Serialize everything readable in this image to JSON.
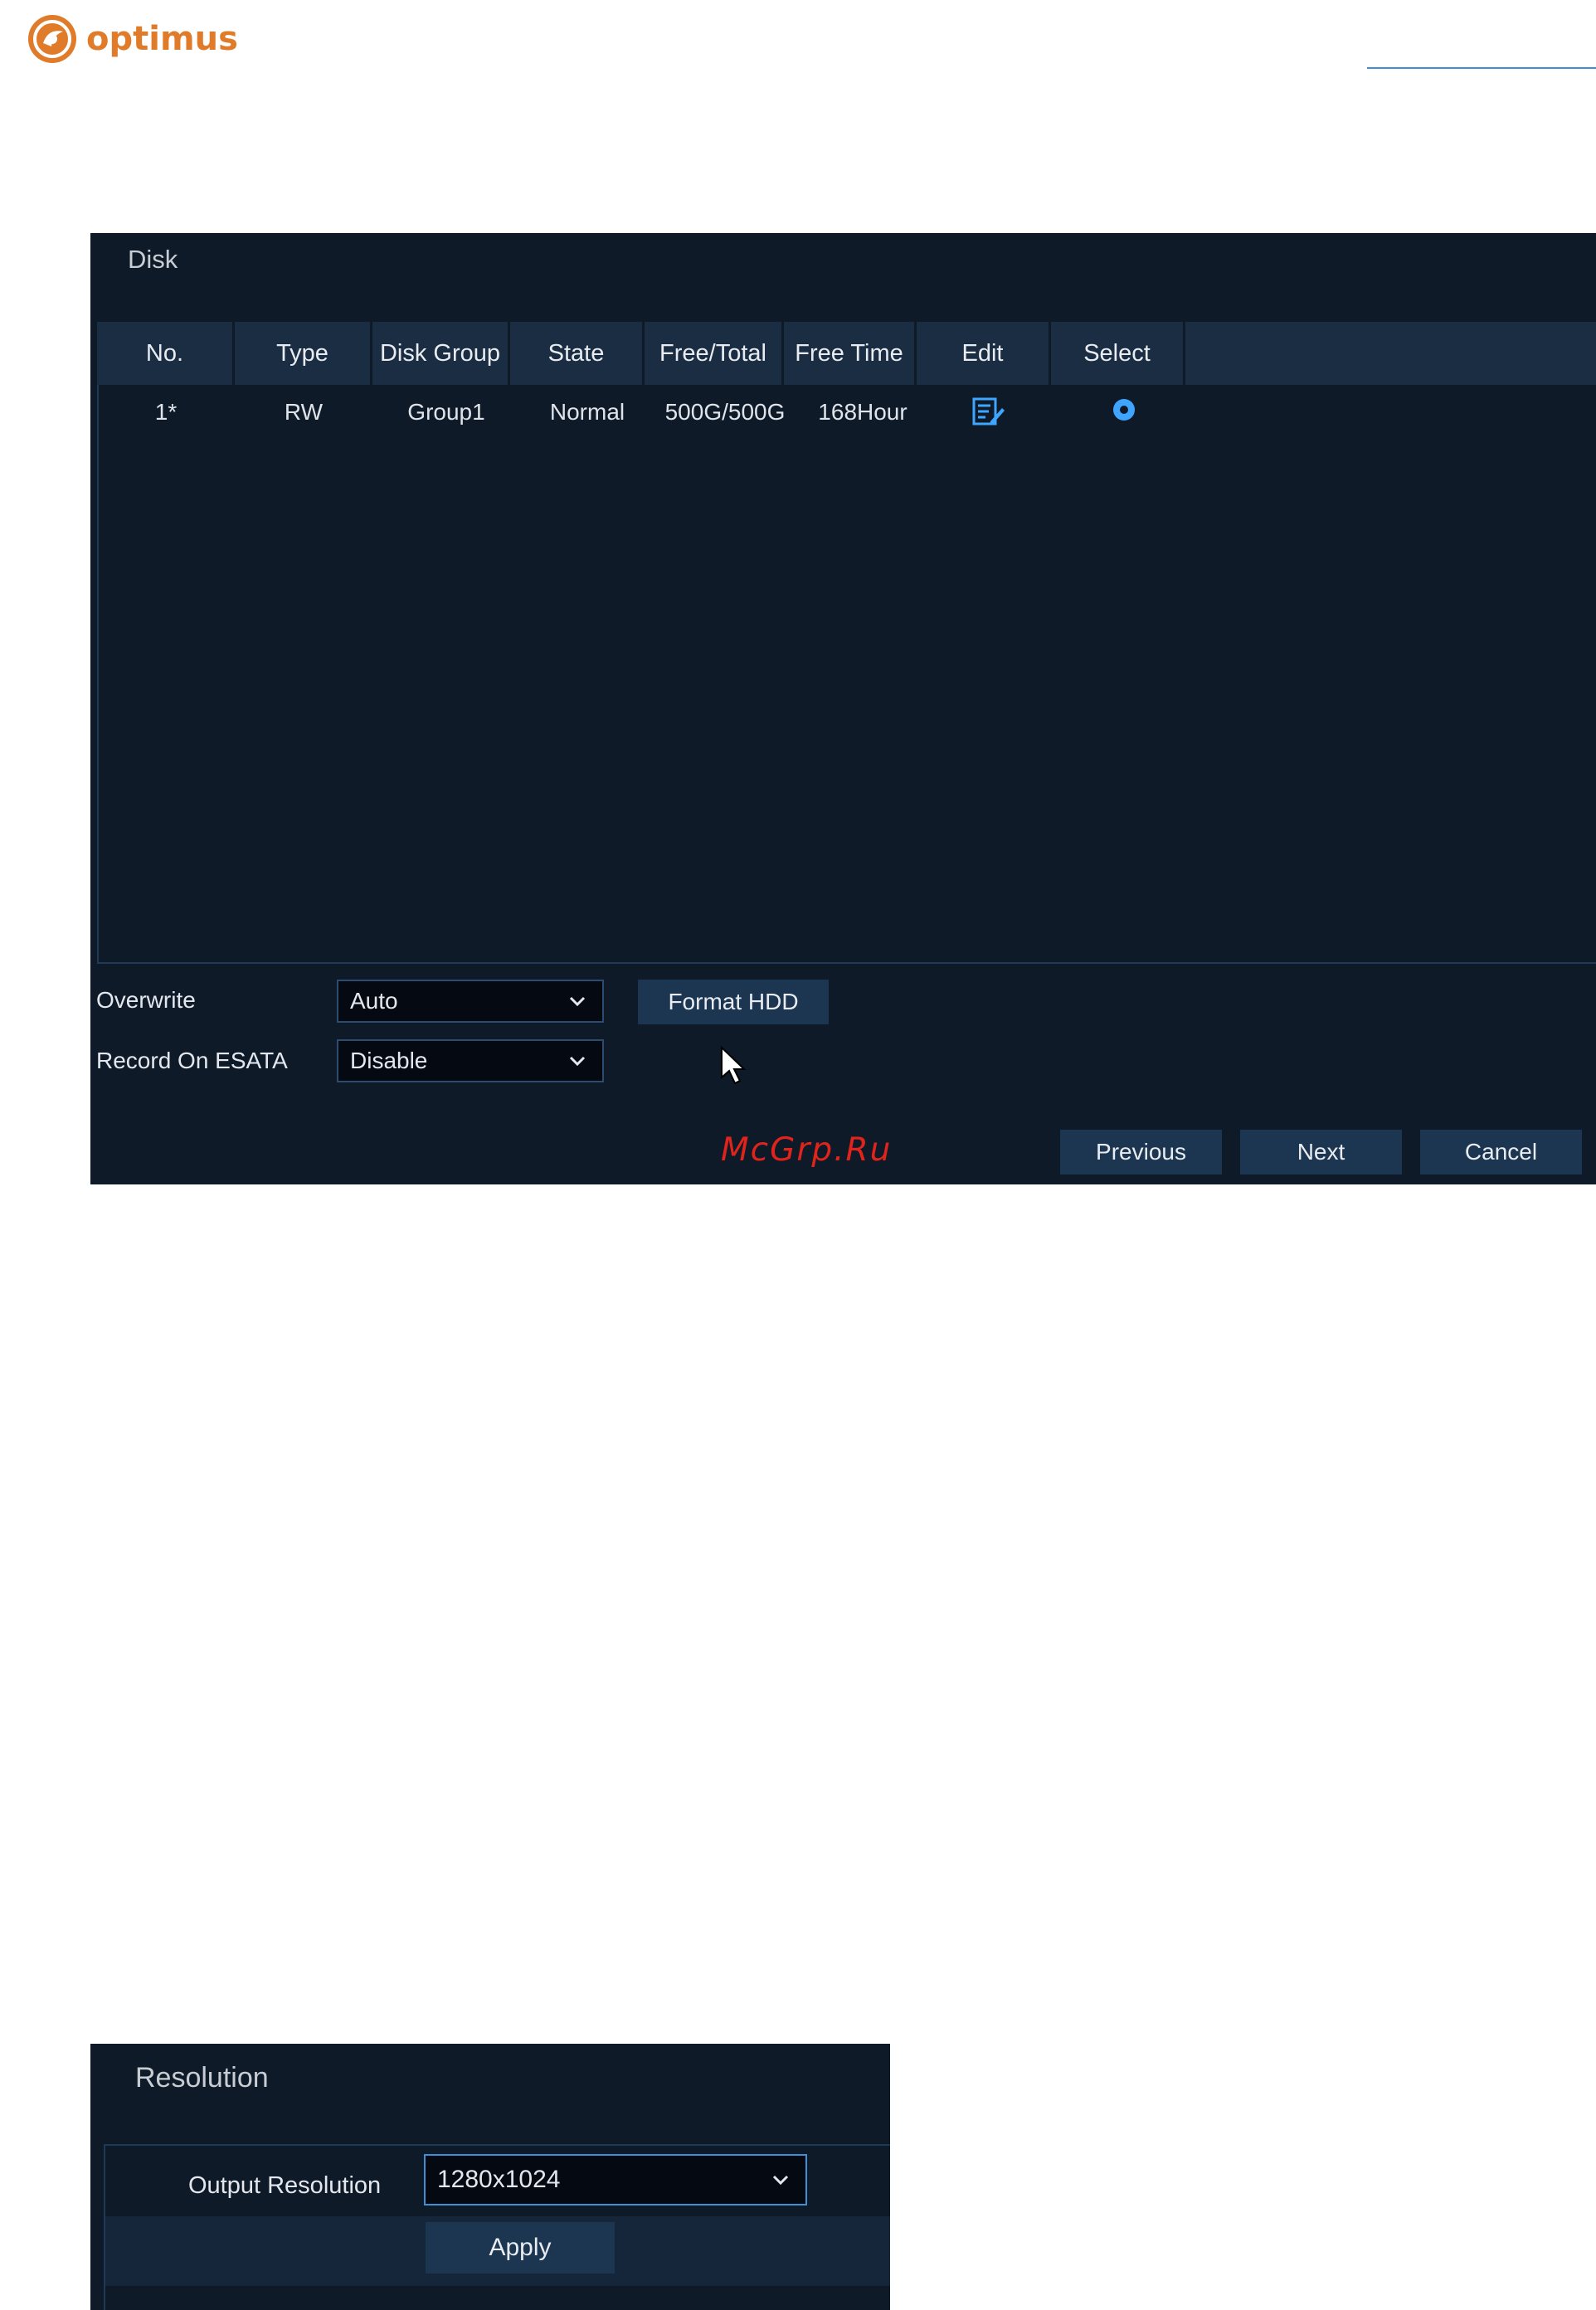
{
  "header": {
    "brand": "optimus",
    "colors": {
      "brand": "#e07b2a",
      "rule": "#3f8fd6"
    }
  },
  "disk": {
    "title": "Disk",
    "columns": [
      "No.",
      "Type",
      "Disk Group",
      "State",
      "Free/Total",
      "Free Time",
      "Edit",
      "Select"
    ],
    "rows": [
      {
        "no": "1*",
        "type": "RW",
        "group": "Group1",
        "state": "Normal",
        "free_total": "500G/500G",
        "free_time": "168Hour",
        "edit_icon": "edit-icon",
        "selected": true
      }
    ],
    "overwrite_label": "Overwrite",
    "overwrite_value": "Auto",
    "esata_label": "Record On ESATA",
    "esata_value": "Disable",
    "format_button": "Format HDD",
    "previous_button": "Previous",
    "next_button": "Next",
    "cancel_button": "Cancel",
    "colors": {
      "panel": "#0f1a29",
      "header": "#1b2d43",
      "button": "#1c3550",
      "accent": "#3fa6ff"
    }
  },
  "watermark": "McGrp.Ru",
  "resolution": {
    "title": "Resolution",
    "output_label": "Output Resolution",
    "output_value": "1280x1024",
    "apply_button": "Apply"
  }
}
